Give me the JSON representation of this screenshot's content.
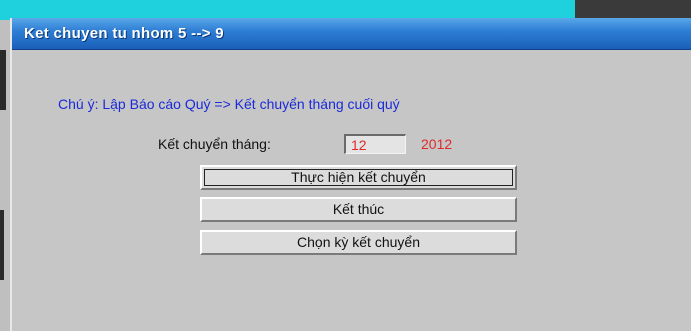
{
  "window": {
    "title": "Ket chuyen tu nhom 5 --> 9"
  },
  "note": "Chú ý: Lập Báo cáo Quý => Kết chuyển tháng cuối quý",
  "form": {
    "month_label": "Kết chuyển tháng:",
    "month_value": "12",
    "year": "2012"
  },
  "buttons": {
    "execute": "Thực hiện kết chuyển",
    "finish": "Kết thúc",
    "choose_period": "Chọn kỳ kết chuyển"
  },
  "colors": {
    "title_bar": "#2f7fd6",
    "note_text": "#1a2ad8",
    "value_text": "#e02a2a",
    "background": "#c6c6c6"
  }
}
